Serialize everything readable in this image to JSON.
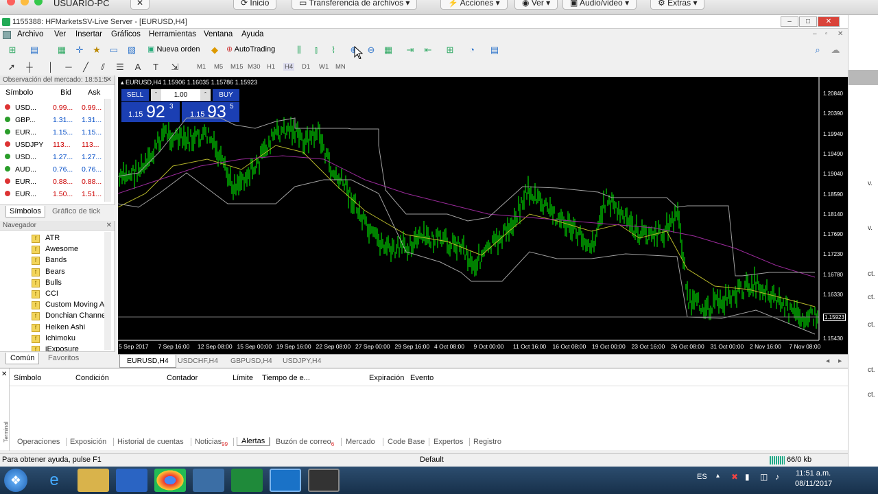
{
  "mac": {
    "title": "USUARIO-PC",
    "buttons": [
      "Inicio",
      "Transferencia de archivos",
      "Acciones",
      "Ver",
      "Audio/video",
      "Extras"
    ]
  },
  "window": {
    "title": "1155388: HFMarketsSV-Live Server - [EURUSD,H4]"
  },
  "menu": [
    "Archivo",
    "Ver",
    "Insertar",
    "Gráficos",
    "Herramientas",
    "Ventana",
    "Ayuda"
  ],
  "toolbar": {
    "new_order": "Nueva orden",
    "autotrading": "AutoTrading"
  },
  "timeframes": [
    "M1",
    "M5",
    "M15",
    "M30",
    "H1",
    "H4",
    "D1",
    "W1",
    "MN"
  ],
  "market": {
    "title": "Observación del mercado: 18:51:5",
    "headers": {
      "symbol": "Símbolo",
      "bid": "Bid",
      "ask": "Ask"
    },
    "rows": [
      {
        "symbol": "USD...",
        "bid": "0.99...",
        "ask": "0.99...",
        "dir": "down"
      },
      {
        "symbol": "GBP...",
        "bid": "1.31...",
        "ask": "1.31...",
        "dir": "up"
      },
      {
        "symbol": "EUR...",
        "bid": "1.15...",
        "ask": "1.15...",
        "dir": "up"
      },
      {
        "symbol": "USDJPY",
        "bid": "113...",
        "ask": "113...",
        "dir": "down"
      },
      {
        "symbol": "USD...",
        "bid": "1.27...",
        "ask": "1.27...",
        "dir": "up"
      },
      {
        "symbol": "AUD...",
        "bid": "0.76...",
        "ask": "0.76...",
        "dir": "up"
      },
      {
        "symbol": "EUR...",
        "bid": "0.88...",
        "ask": "0.88...",
        "dir": "down"
      },
      {
        "symbol": "EUR...",
        "bid": "1.50...",
        "ask": "1.51...",
        "dir": "down"
      }
    ],
    "tabs": [
      "Símbolos",
      "Gráfico de tick"
    ]
  },
  "navigator": {
    "title": "Navegador",
    "items": [
      "ATR",
      "Awesome",
      "Bands",
      "Bears",
      "Bulls",
      "CCI",
      "Custom Moving A",
      "Donchian Channe",
      "Heiken Ashi",
      "Ichimoku",
      "iExposure"
    ],
    "tabs": [
      "Común",
      "Favoritos"
    ]
  },
  "chart": {
    "header": "EURUSD,H4  1.15906 1.16035 1.15786 1.15923",
    "sell_label": "SELL",
    "buy_label": "BUY",
    "lot": "1.00",
    "sell_prefix": "1.15",
    "sell_big": "92",
    "sell_sup": "3",
    "buy_prefix": "1.15",
    "buy_big": "93",
    "buy_sup": "5",
    "price_levels": [
      "1.20840",
      "1.20390",
      "1.19940",
      "1.19490",
      "1.19040",
      "1.18590",
      "1.18140",
      "1.17690",
      "1.17230",
      "1.16780",
      "1.16330",
      "1.15923",
      "1.15430"
    ],
    "current_price": "1.15923",
    "time_labels": [
      "5 Sep 2017",
      "7 Sep 16:00",
      "12 Sep 08:00",
      "15 Sep 00:00",
      "19 Sep 16:00",
      "22 Sep 08:00",
      "27 Sep 00:00",
      "29 Sep 16:00",
      "4 Oct 08:00",
      "9 Oct 00:00",
      "11 Oct 16:00",
      "16 Oct 08:00",
      "19 Oct 00:00",
      "23 Oct 16:00",
      "26 Oct 08:00",
      "31 Oct 00:00",
      "2 Nov 16:00",
      "7 Nov 08:00"
    ],
    "colors": {
      "bars": "#00ff00",
      "ma_fast": "#b5b52a",
      "ma_slow": "#9a2a9a",
      "channel": "#a0a0a0",
      "blue": "#3030d0"
    }
  },
  "chart_tabs": [
    "EURUSD,H4",
    "USDCHF,H4",
    "GBPUSD,H4",
    "USDJPY,H4"
  ],
  "terminal": {
    "headers": [
      "Símbolo",
      "Condición",
      "Contador",
      "Límite",
      "Tiempo de e...",
      "Expiración",
      "Evento"
    ],
    "side_label": "Terminal",
    "tabs": [
      {
        "label": "Operaciones"
      },
      {
        "label": "Exposición"
      },
      {
        "label": "Historial de cuentas"
      },
      {
        "label": "Noticias",
        "badge": "99"
      },
      {
        "label": "Alertas"
      },
      {
        "label": "Buzón de correo",
        "badge": "6"
      },
      {
        "label": "Mercado"
      },
      {
        "label": "Code Base"
      },
      {
        "label": "Expertos"
      },
      {
        "label": "Registro"
      }
    ]
  },
  "status": {
    "help": "Para obtener ayuda, pulse F1",
    "profile": "Default",
    "traffic": "66/0 kb"
  },
  "taskbar": {
    "lang": "ES",
    "time": "11:51 a.m.",
    "date": "08/11/2017"
  }
}
